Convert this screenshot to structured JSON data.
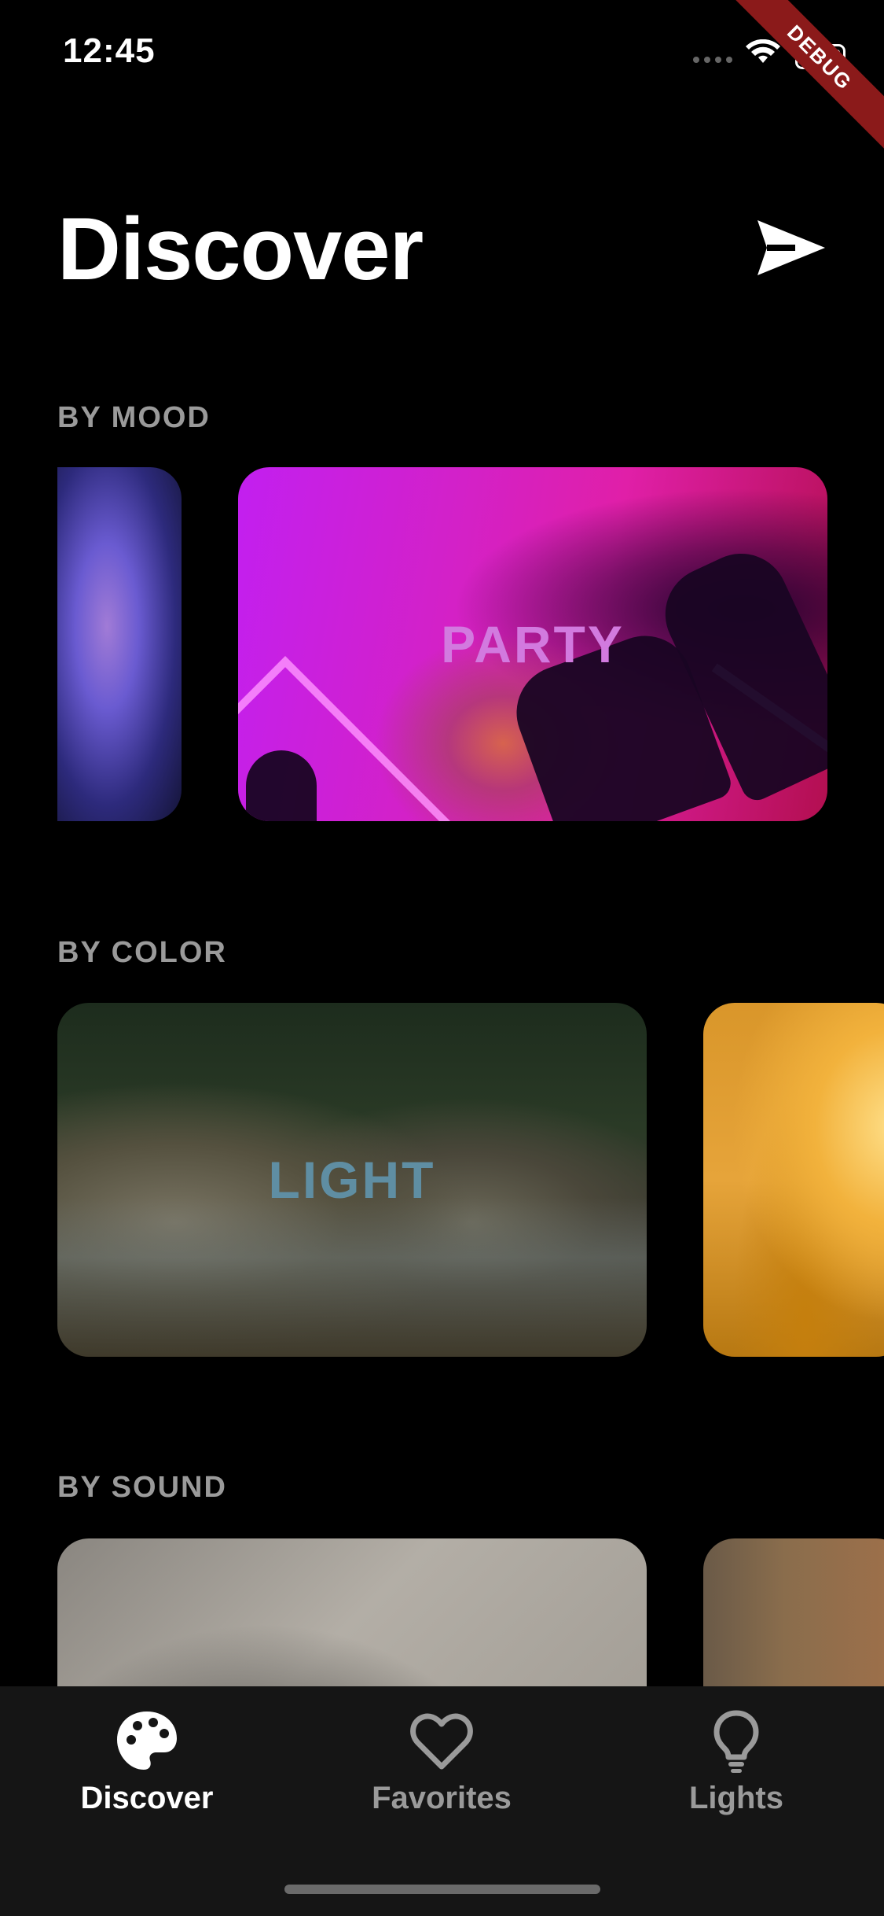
{
  "status_bar": {
    "time": "12:45",
    "icons": [
      "signal-icon",
      "wifi-icon",
      "battery-icon"
    ]
  },
  "debug_banner": "DEBUG",
  "header": {
    "title": "Discover",
    "action_icon": "send-icon"
  },
  "sections": [
    {
      "label": "BY MOOD",
      "cards": [
        {
          "title": "",
          "image": "woman-purple-light"
        },
        {
          "title": "PARTY",
          "image": "concert-crowd-pink",
          "title_color": "#d27adf"
        }
      ]
    },
    {
      "label": "BY COLOR",
      "cards": [
        {
          "title": "LIGHT",
          "image": "forest-river-rocks",
          "title_color": "#5f8ea3"
        },
        {
          "title": "",
          "image": "sunset-clouds"
        }
      ]
    },
    {
      "label": "BY SOUND",
      "cards": [
        {
          "title": "",
          "image": "seashell-grayscale"
        },
        {
          "title": "",
          "image": "blurred-warm"
        }
      ]
    }
  ],
  "tab_bar": {
    "tabs": [
      {
        "label": "Discover",
        "icon": "palette-icon",
        "active": true
      },
      {
        "label": "Favorites",
        "icon": "heart-icon",
        "active": false
      },
      {
        "label": "Lights",
        "icon": "lightbulb-icon",
        "active": false
      }
    ]
  },
  "colors": {
    "background": "#000000",
    "tab_bar_bg": "#151515",
    "section_label": "#9a9a9a",
    "inactive_tab": "#9a9a9a",
    "debug_ribbon": "#8b1a1a"
  }
}
